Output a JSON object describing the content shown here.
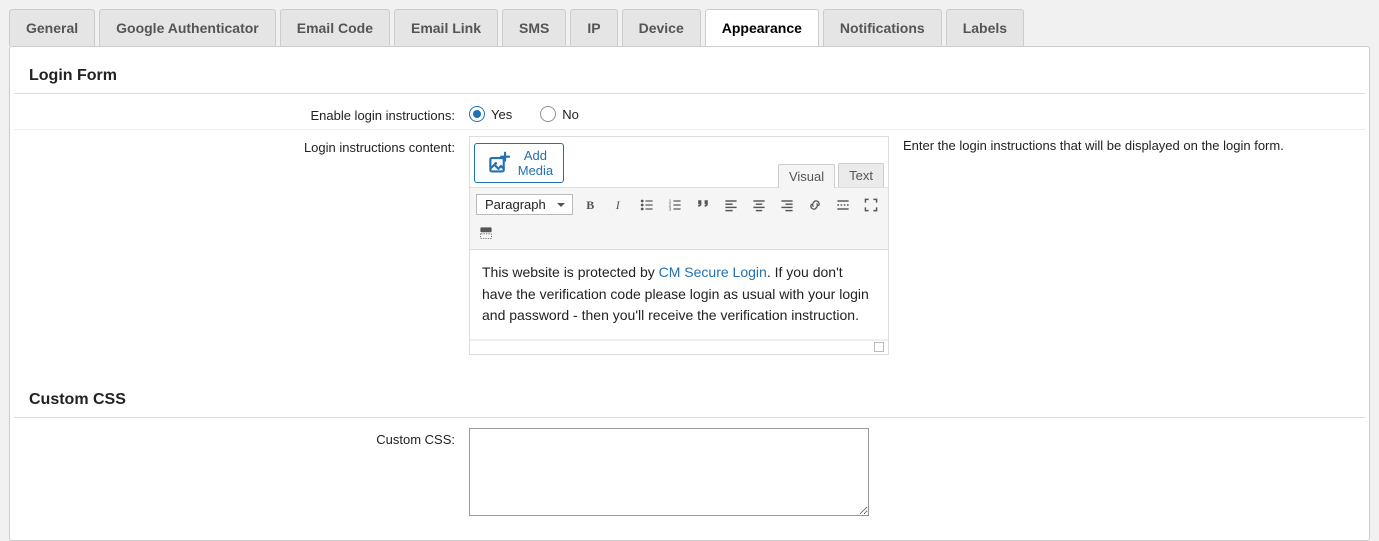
{
  "tabs": [
    {
      "label": "General"
    },
    {
      "label": "Google Authenticator"
    },
    {
      "label": "Email Code"
    },
    {
      "label": "Email Link"
    },
    {
      "label": "SMS"
    },
    {
      "label": "IP"
    },
    {
      "label": "Device"
    },
    {
      "label": "Appearance",
      "active": true
    },
    {
      "label": "Notifications"
    },
    {
      "label": "Labels"
    }
  ],
  "section1_title": "Login Form",
  "row_enable": {
    "label": "Enable login instructions:",
    "yes": "Yes",
    "no": "No",
    "selected": "yes"
  },
  "row_content": {
    "label": "Login instructions content:",
    "add_media": "Add Media",
    "editor_tab_visual": "Visual",
    "editor_tab_text": "Text",
    "paragraph": "Paragraph",
    "body_before": "This website is protected by ",
    "body_link": "CM Secure Login",
    "body_after": ". If you don't have the verification code please login as usual with your login and password - then you'll receive the verification instruction.",
    "help": "Enter the login instructions that will be displayed on the login form."
  },
  "section2_title": "Custom CSS",
  "row_css": {
    "label": "Custom CSS:",
    "value": ""
  }
}
